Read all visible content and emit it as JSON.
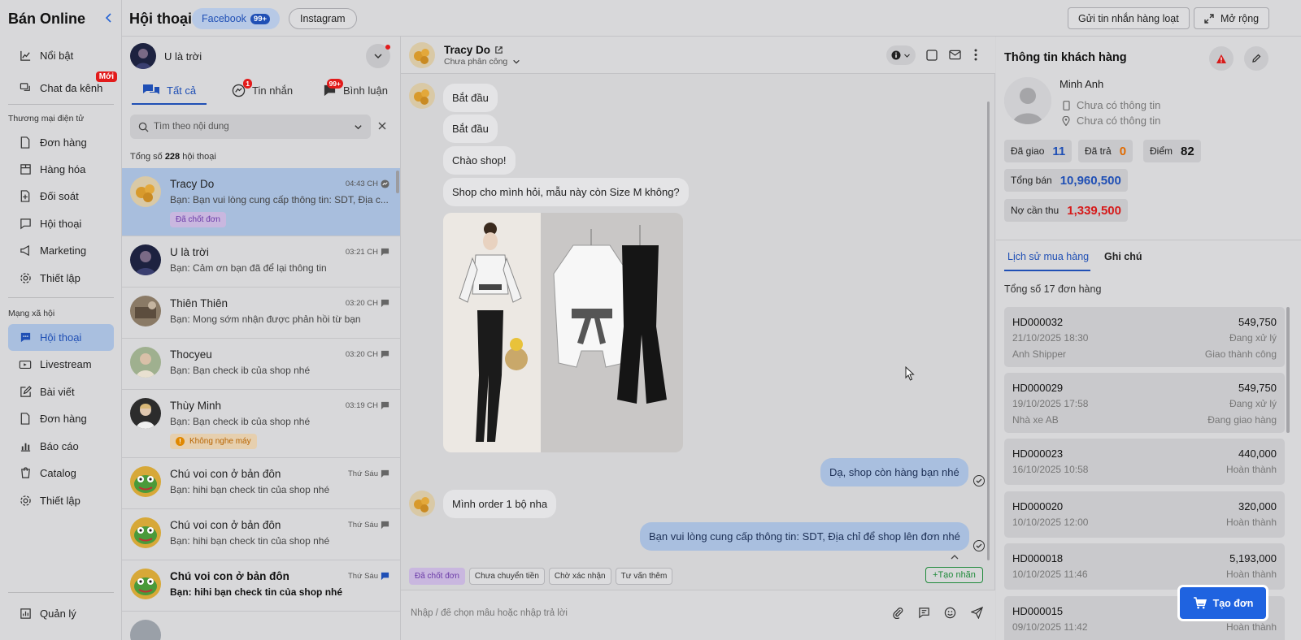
{
  "sidebar": {
    "brand": "Bán Online",
    "items_top": [
      {
        "label": "Nổi bật",
        "icon": "chart-icon"
      },
      {
        "label": "Chat đa kênh",
        "icon": "chat-multi-icon",
        "badge": "Mới"
      }
    ],
    "section_ecom": "Thương mại điện tử",
    "items_ecom": [
      {
        "label": "Đơn hàng",
        "icon": "document-icon"
      },
      {
        "label": "Hàng hóa",
        "icon": "box-icon"
      },
      {
        "label": "Đối soát",
        "icon": "reconcile-icon"
      },
      {
        "label": "Hội thoại",
        "icon": "message-icon"
      },
      {
        "label": "Marketing",
        "icon": "megaphone-icon"
      },
      {
        "label": "Thiết lập",
        "icon": "gear-icon"
      }
    ],
    "section_social": "Mạng xã hội",
    "items_social": [
      {
        "label": "Hội thoại",
        "icon": "message-icon",
        "active": true
      },
      {
        "label": "Livestream",
        "icon": "livestream-icon"
      },
      {
        "label": "Bài viết",
        "icon": "edit-icon"
      },
      {
        "label": "Đơn hàng",
        "icon": "document-icon"
      },
      {
        "label": "Báo cáo",
        "icon": "bar-chart-icon"
      },
      {
        "label": "Catalog",
        "icon": "catalog-icon"
      },
      {
        "label": "Thiết lập",
        "icon": "gear-icon"
      }
    ],
    "bottom": {
      "label": "Quản lý",
      "icon": "report-icon"
    }
  },
  "header": {
    "title": "Hội thoại",
    "channel_facebook": "Facebook",
    "facebook_count": "99+",
    "channel_instagram": "Instagram",
    "bulk_message": "Gửi tin nhắn hàng loạt",
    "expand": "Mở rộng"
  },
  "conversations": {
    "page_name": "U là trời",
    "tabs": [
      {
        "label": "Tất cả",
        "active": true
      },
      {
        "label": "Tin nhắn",
        "badge": "1"
      },
      {
        "label": "Bình luận",
        "badge": "99+"
      }
    ],
    "search_placeholder": "Tìm theo nội dung",
    "total_prefix": "Tổng số",
    "total_count": "228",
    "total_suffix": "hội thoại",
    "items": [
      {
        "name": "Tracy Do",
        "msg": "Bạn: Bạn vui lòng cung cấp thông tin: SDT, Địa c...",
        "time": "04:43 CH",
        "tag": "Đã chốt đơn",
        "selected": true
      },
      {
        "name": "U là trời",
        "msg": "Bạn: Cảm ơn bạn đã để lại thông tin",
        "time": "03:21 CH"
      },
      {
        "name": "Thiên Thiên",
        "msg": "Bạn: Mong sớm nhận được phản hồi từ bạn",
        "time": "03:20 CH"
      },
      {
        "name": "Thocyeu",
        "msg": "Bạn: Bạn check ib của shop nhé",
        "time": "03:20 CH"
      },
      {
        "name": "Thùy Minh",
        "msg": "Bạn: Bạn check ib của shop nhé",
        "time": "03:19 CH",
        "tag": "Không nghe máy"
      },
      {
        "name": "Chú voi con ở bản đôn",
        "msg": "Bạn: hihi bạn check tin của shop nhé",
        "time": "Thứ Sáu"
      },
      {
        "name": "Chú voi con ở bản đôn",
        "msg": "Bạn: hihi bạn check tin của shop nhé",
        "time": "Thứ Sáu"
      },
      {
        "name": "Chú voi con ở bản đôn",
        "msg": "Bạn: hihi bạn check tin của shop nhé",
        "time": "Thứ Sáu",
        "unread": true
      }
    ]
  },
  "chat": {
    "name": "Tracy Do",
    "assign": "Chưa phân công",
    "messages": [
      {
        "from": "customer",
        "text": "Bắt đầu"
      },
      {
        "from": "customer",
        "text": "Bắt đầu"
      },
      {
        "from": "customer",
        "text": "Chào shop!"
      },
      {
        "from": "customer",
        "text": "Shop cho mình hỏi, mẫu này còn Size M không?"
      },
      {
        "from": "shop",
        "text": "Dạ, shop còn hàng bạn nhé"
      },
      {
        "from": "customer",
        "text": "Mình order 1 bộ nha"
      },
      {
        "from": "shop",
        "text": "Bạn vui lòng cung cấp thông tin: SDT, Địa chỉ để shop lên đơn nhé"
      }
    ],
    "quick_tags": [
      "Đã chốt đơn",
      "Chưa chuyển tiền",
      "Chờ xác nhận",
      "Tư vấn thêm"
    ],
    "add_tag": "Tạo nhãn",
    "input_placeholder": "Nhập / để chọn mẫu hoặc nhập trả lời"
  },
  "customer": {
    "title": "Thông tin khách hàng",
    "name": "Minh Anh",
    "phone": "Chưa có thông tin",
    "address": "Chưa có thông tin",
    "delivered_label": "Đã giao",
    "delivered": "11",
    "returned_label": "Đã trả",
    "returned": "0",
    "points_label": "Điểm",
    "points": "82",
    "total_sales_label": "Tổng bán",
    "total_sales": "10,960,500",
    "debt_label": "Nợ cần thu",
    "debt": "1,339,500",
    "tabs": [
      "Lịch sử mua hàng",
      "Ghi chú"
    ],
    "orders_total": "Tổng số 17 đơn hàng",
    "orders": [
      {
        "id": "HD000032",
        "amount": "549,750",
        "date": "21/10/2025 18:30",
        "status": "Đang xử lý",
        "shipper": "Anh Shipper",
        "delivery": "Giao thành công"
      },
      {
        "id": "HD000029",
        "amount": "549,750",
        "date": "19/10/2025 17:58",
        "status": "Đang xử lý",
        "shipper": "Nhà xe AB",
        "delivery": "Đang giao hàng"
      },
      {
        "id": "HD000023",
        "amount": "440,000",
        "date": "16/10/2025 10:58",
        "status": "Hoàn thành"
      },
      {
        "id": "HD000020",
        "amount": "320,000",
        "date": "10/10/2025 12:00",
        "status": "Hoàn thành"
      },
      {
        "id": "HD000018",
        "amount": "5,193,000",
        "date": "10/10/2025 11:46",
        "status": "Hoàn thành"
      },
      {
        "id": "HD000015",
        "amount": "",
        "date": "09/10/2025 11:42",
        "status": "Hoàn thành"
      }
    ],
    "create_order": "Tạo đơn"
  }
}
